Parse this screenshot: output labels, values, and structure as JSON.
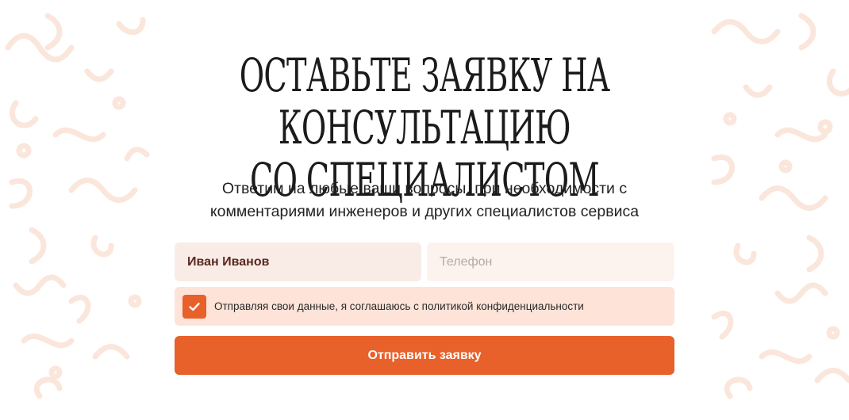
{
  "headline": {
    "line1": "Оставьте заявку на консультацию",
    "line2": "со специалистом"
  },
  "subtitle": {
    "line1": "Ответим на любые ваши вопросы, при необходимости с",
    "line2": "комментариями инженеров и других специалистов сервиса"
  },
  "form": {
    "name_value": "Иван Иванов",
    "phone_placeholder": "Телефон",
    "consent_checked": true,
    "consent_label": "Отправляя свои данные, я соглашаюсь с политикой конфиденциальности",
    "submit_label": "Отправить заявку"
  },
  "colors": {
    "accent": "#e8602a",
    "name_field_bg": "#f9ece7",
    "phone_field_bg": "#fcf3ef",
    "consent_bg": "#fde3d8",
    "doodle": "#fbe4d9"
  },
  "icons": {
    "checkbox": "check-icon"
  }
}
